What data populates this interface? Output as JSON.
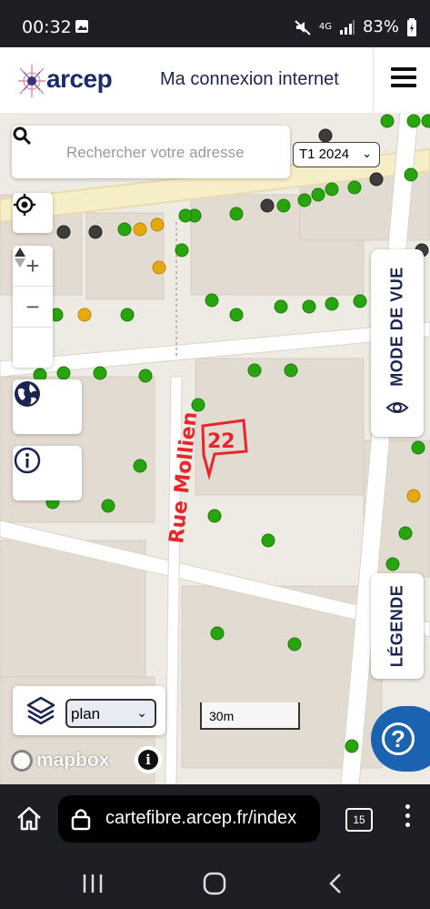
{
  "status_bar": {
    "time": "00:32",
    "network": "4G",
    "battery": "83%",
    "icons": [
      "image-icon",
      "mute-icon",
      "signal-icon",
      "battery-icon"
    ]
  },
  "header": {
    "logo_text": "arcep",
    "title": "Ma connexion internet",
    "menu_icon": "hamburger-menu-icon"
  },
  "map": {
    "search": {
      "placeholder": "Rechercher votre adresse",
      "value": ""
    },
    "period": {
      "selected": "T1 2024"
    },
    "controls": [
      "locate-icon",
      "zoom-in-icon",
      "zoom-out-icon",
      "compass-icon"
    ],
    "buttons": [
      "globe-icon",
      "info-icon"
    ],
    "view_mode_label": "MODE DE VUE",
    "legend_label": "LÉGENDE",
    "layer_select": {
      "selected": "plan"
    },
    "scale_label": "30m",
    "attribution": "mapbox",
    "annotations": {
      "street": "Rue Mollien",
      "number": "22"
    },
    "colors": {
      "eligible": "#27a40e",
      "partial": "#e3a90e",
      "not_eligible": "#3d3d3d",
      "annotation": "#e8262a",
      "accent": "#1b62b0"
    }
  },
  "browser": {
    "url": "cartefibre.arcep.fr/index",
    "tab_count": "15"
  },
  "nav": [
    "recent-apps-icon",
    "home-icon",
    "back-icon"
  ]
}
